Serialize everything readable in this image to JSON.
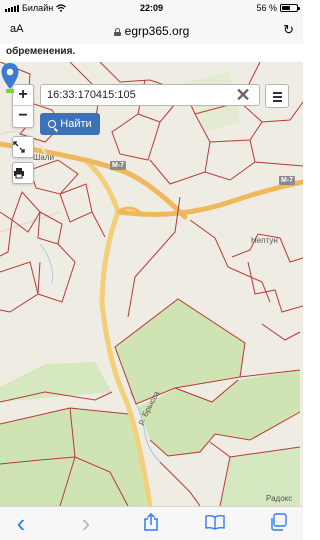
{
  "status": {
    "carrier": "Билайн",
    "time": "22:09",
    "battery": "56 %",
    "battery_level": 0.56
  },
  "browser": {
    "aa_label": "aA",
    "url": "egrp365.org",
    "reload_glyph": "↻"
  },
  "page": {
    "text_fragment": "обременения."
  },
  "map": {
    "search_value": "16:33:170415:105",
    "find_label": "Найти",
    "zoom_in": "+",
    "zoom_out": "−",
    "labels": {
      "shali": "Шали",
      "neptun": "Нептун",
      "river": "р. Брысса",
      "ryadoks": "Радокс"
    },
    "road_badges": {
      "m7_west": "М-7",
      "m7_east": "М-7"
    },
    "colors": {
      "land": "#efece4",
      "forest": "#cfe4b2",
      "parcel_border": "#b73a3a",
      "road": "#f3cf7a",
      "highway": "#f0b85c",
      "pin": "#3c7bd1"
    }
  },
  "toolbar": {
    "back": "‹",
    "forward": "›"
  }
}
